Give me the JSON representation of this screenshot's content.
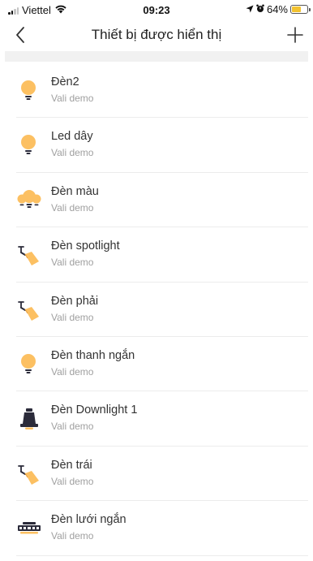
{
  "status_bar": {
    "carrier": "Viettel",
    "time": "09:23",
    "battery": "64%"
  },
  "header": {
    "title": "Thiết bị được hiển thị",
    "back_icon": "chevron-left-icon",
    "add_icon": "plus-icon"
  },
  "devices": [
    {
      "name": "Đèn2",
      "room": "Vali demo",
      "icon": "bulb-icon"
    },
    {
      "name": "Led dây",
      "room": "Vali demo",
      "icon": "bulb-icon"
    },
    {
      "name": "Đèn màu",
      "room": "Vali demo",
      "icon": "multi-bulb-icon"
    },
    {
      "name": "Đèn spotlight",
      "room": "Vali demo",
      "icon": "spotlight-icon"
    },
    {
      "name": "Đèn phải",
      "room": "Vali demo",
      "icon": "spotlight-icon"
    },
    {
      "name": "Đèn thanh ngắn",
      "room": "Vali demo",
      "icon": "bulb-icon"
    },
    {
      "name": "Đèn Downlight 1",
      "room": "Vali demo",
      "icon": "downlight-icon"
    },
    {
      "name": "Đèn trái",
      "room": "Vali demo",
      "icon": "spotlight-icon"
    },
    {
      "name": "Đèn lưới ngắn",
      "room": "Vali demo",
      "icon": "grille-light-icon"
    }
  ],
  "colors": {
    "bulb": "#fcc062",
    "base": "#2b2b3a",
    "separator": "#f1f1f1",
    "subtitle": "#a0a0a0"
  }
}
